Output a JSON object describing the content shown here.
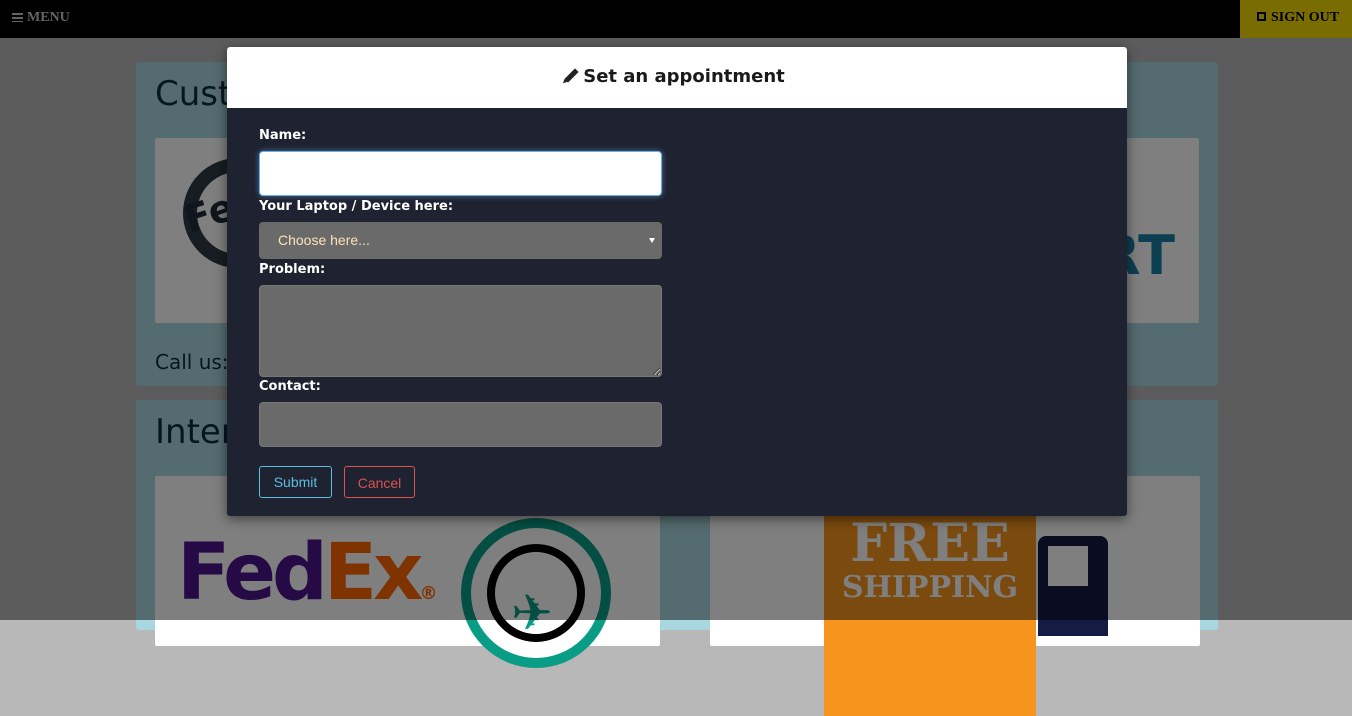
{
  "navbar": {
    "menu_label": "MENU",
    "signout_label": "SIGN OUT"
  },
  "background": {
    "panel1_heading": "Cust",
    "panel1_callus": "Call us:",
    "panel1_card_left_text": "Feed",
    "panel1_card_right_text": "RT",
    "panel2_heading": "Inter",
    "fedex_fed": "Fed",
    "fedex_ex": "Ex",
    "fedex_reg": "®",
    "free_line1": "FREE",
    "free_line2": "SHIPPING"
  },
  "modal": {
    "title": "Set an appointment",
    "name_label": "Name:",
    "name_value": "",
    "device_label": "Your Laptop / Device here:",
    "device_selected": "Choose here...",
    "problem_label": "Problem:",
    "problem_value": "",
    "contact_label": "Contact:",
    "contact_value": "",
    "submit_label": "Submit",
    "cancel_label": "Cancel"
  },
  "colors": {
    "accent_submit": "#5bc0de",
    "accent_cancel": "#d9534f",
    "modal_body": "#1f2230",
    "signout_bg": "#f2d800"
  }
}
